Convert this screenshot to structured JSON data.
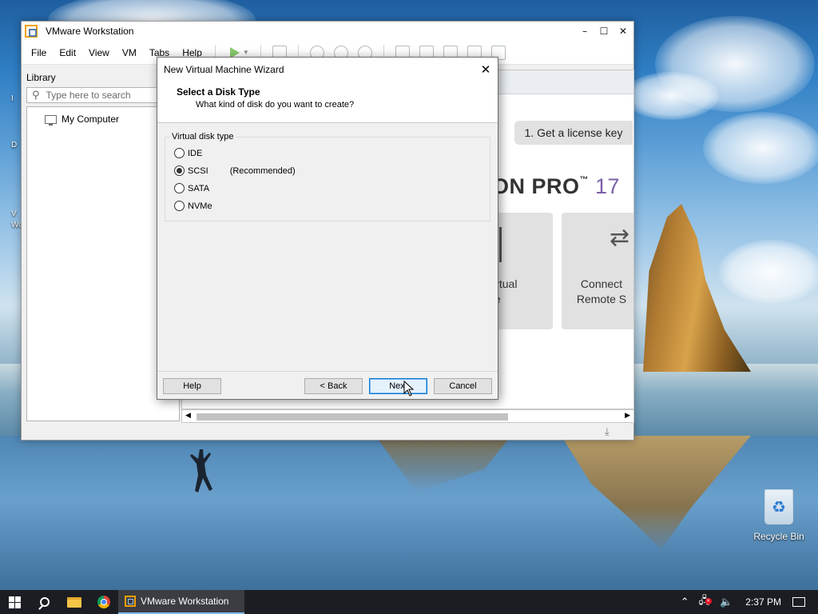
{
  "desktop": {
    "recycle_bin_label": "Recycle Bin",
    "edge_icon_fragments": [
      "I",
      "D",
      "V",
      "Wo"
    ]
  },
  "vmware_window": {
    "title": "VMware Workstation",
    "menu": [
      "File",
      "Edit",
      "View",
      "VM",
      "Tabs",
      "Help"
    ],
    "library_label": "Library",
    "search_placeholder": "Type here to search",
    "tree": [
      {
        "label": "My Computer",
        "icon": "computer-icon"
      }
    ],
    "home": {
      "license_button": "1. Get a license key",
      "brand_text": "ON PRO",
      "brand_tm": "™",
      "brand_version": "17",
      "tile1_lines": [
        "Virtual",
        "ine"
      ],
      "tile2_lines": [
        "Connect",
        "Remote S"
      ]
    }
  },
  "wizard": {
    "title": "New Virtual Machine Wizard",
    "heading": "Select a Disk Type",
    "subheading": "What kind of disk do you want to create?",
    "group_label": "Virtual disk type",
    "options": [
      {
        "label": "IDE",
        "checked": false,
        "note": ""
      },
      {
        "label": "SCSI",
        "checked": true,
        "note": "(Recommended)"
      },
      {
        "label": "SATA",
        "checked": false,
        "note": ""
      },
      {
        "label": "NVMe",
        "checked": false,
        "note": ""
      }
    ],
    "buttons": {
      "help": "Help",
      "back": "< Back",
      "next": "Next",
      "cancel": "Cancel"
    }
  },
  "taskbar": {
    "active_task": "VMware Workstation",
    "clock": "2:37 PM"
  }
}
